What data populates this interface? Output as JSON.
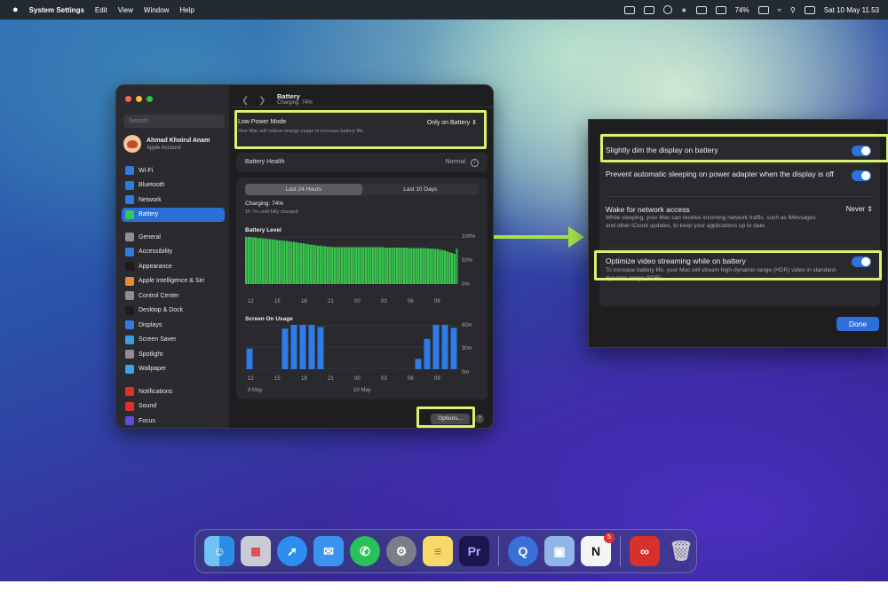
{
  "menubar": {
    "apple": "",
    "app": "System Settings",
    "items": [
      "Edit",
      "View",
      "Window",
      "Help"
    ],
    "battery_pct": "74%",
    "datetime": "Sat 10 May 11.53"
  },
  "sidebar": {
    "search_placeholder": "Search",
    "account_name": "Ahmad Khoirul Anam",
    "account_sub": "Apple Account",
    "group1": [
      {
        "label": "Wi-Fi",
        "color": "#2f7be0",
        "icon": "wifi-icon"
      },
      {
        "label": "Bluetooth",
        "color": "#2f7be0",
        "icon": "bluetooth-icon"
      },
      {
        "label": "Network",
        "color": "#2f7be0",
        "icon": "globe-icon"
      },
      {
        "label": "Battery",
        "color": "#34c759",
        "icon": "battery-icon",
        "active": true
      }
    ],
    "group2": [
      {
        "label": "General",
        "color": "#8e8e93",
        "icon": "gear-icon"
      },
      {
        "label": "Accessibility",
        "color": "#2f7be0",
        "icon": "accessibility-icon"
      },
      {
        "label": "Appearance",
        "color": "#1c1c1e",
        "icon": "appearance-icon"
      },
      {
        "label": "Apple Intelligence & Siri",
        "color": "#e88c3a",
        "icon": "siri-icon"
      },
      {
        "label": "Control Center",
        "color": "#8e8e93",
        "icon": "control-center-icon"
      },
      {
        "label": "Desktop & Dock",
        "color": "#1c1c1e",
        "icon": "dock-icon"
      },
      {
        "label": "Displays",
        "color": "#2f7be0",
        "icon": "display-icon"
      },
      {
        "label": "Screen Saver",
        "color": "#39a0e0",
        "icon": "screensaver-icon"
      },
      {
        "label": "Spotlight",
        "color": "#8e8e93",
        "icon": "spotlight-icon"
      },
      {
        "label": "Wallpaper",
        "color": "#3aa6e8",
        "icon": "wallpaper-icon"
      }
    ],
    "group3": [
      {
        "label": "Notifications",
        "color": "#e0302a",
        "icon": "bell-icon"
      },
      {
        "label": "Sound",
        "color": "#e0302a",
        "icon": "speaker-icon"
      },
      {
        "label": "Focus",
        "color": "#5b4fd6",
        "icon": "moon-icon"
      }
    ]
  },
  "battery": {
    "title": "Battery",
    "subtitle": "Charging: 74%",
    "low_power_label": "Low Power Mode",
    "low_power_desc": "Your Mac will reduce energy usage to increase battery life.",
    "low_power_value": "Only on Battery",
    "health_label": "Battery Health",
    "health_value": "Normal",
    "tab_24h": "Last 24 Hours",
    "tab_10d": "Last 10 Days",
    "charging": "Charging: 74%",
    "charging_sub": "1h 7m until fully charged",
    "level_title": "Battery Level",
    "level_axis": [
      "100%",
      "50%",
      "0%"
    ],
    "usage_title": "Screen On Usage",
    "usage_axis": [
      "60m",
      "30m",
      "0m"
    ],
    "time_ticks": [
      "12",
      "15",
      "18",
      "21",
      "00",
      "03",
      "06",
      "09"
    ],
    "date_ticks": [
      "9 May",
      "10 May"
    ],
    "options_label": "Options...",
    "help_label": "?"
  },
  "options_panel": {
    "row1_title": "Slightly dim the display on battery",
    "row2_title": "Prevent automatic sleeping on power adapter when the display is off",
    "row3_title": "Wake for network access",
    "row3_value": "Never",
    "row3_desc": "While sleeping, your Mac can receive incoming network traffic, such as iMessages and other iCloud updates, to keep your applications up to date.",
    "row4_title": "Optimize video streaming while on battery",
    "row4_desc": "To increase battery life, your Mac will stream high-dynamic-range (HDR) video in standard-dynamic-range (SDR).",
    "done_label": "Done"
  },
  "chart_data": [
    {
      "type": "bar",
      "title": "Battery Level",
      "ylabel": "",
      "ylim": [
        0,
        100
      ],
      "x_ticks": [
        "12",
        "15",
        "18",
        "21",
        "00",
        "03",
        "06",
        "09"
      ],
      "values": [
        98,
        98,
        98,
        97,
        97,
        96,
        96,
        95,
        95,
        94,
        94,
        93,
        93,
        92,
        91,
        91,
        90,
        90,
        89,
        88,
        88,
        87,
        86,
        85,
        85,
        84,
        83,
        82,
        82,
        81,
        80,
        80,
        79,
        79,
        78,
        78,
        77,
        77,
        77,
        77,
        77,
        77,
        77,
        77,
        77,
        77,
        77,
        77,
        77,
        77,
        77,
        77,
        77,
        77,
        77,
        77,
        77,
        77,
        76,
        76,
        76,
        76,
        76,
        76,
        76,
        76,
        76,
        76,
        75,
        75,
        75,
        75,
        75,
        75,
        75,
        75,
        74,
        74,
        74,
        73,
        73,
        72,
        71,
        70,
        68,
        66,
        65,
        63,
        74
      ]
    },
    {
      "type": "bar",
      "title": "Screen On Usage",
      "ylabel": "",
      "ylim": [
        0,
        60
      ],
      "x_ticks": [
        "12",
        "15",
        "18",
        "21",
        "00",
        "03",
        "06",
        "09"
      ],
      "categories": [
        "11",
        "12",
        "13",
        "14",
        "15",
        "16",
        "17",
        "18",
        "19",
        "20",
        "21",
        "22",
        "23",
        "00",
        "01",
        "02",
        "03",
        "04",
        "05",
        "06",
        "07",
        "08",
        "09",
        "10"
      ],
      "values": [
        28,
        0,
        0,
        0,
        55,
        60,
        60,
        60,
        57,
        0,
        0,
        0,
        0,
        0,
        0,
        0,
        0,
        0,
        0,
        14,
        41,
        60,
        60,
        56
      ]
    }
  ]
}
